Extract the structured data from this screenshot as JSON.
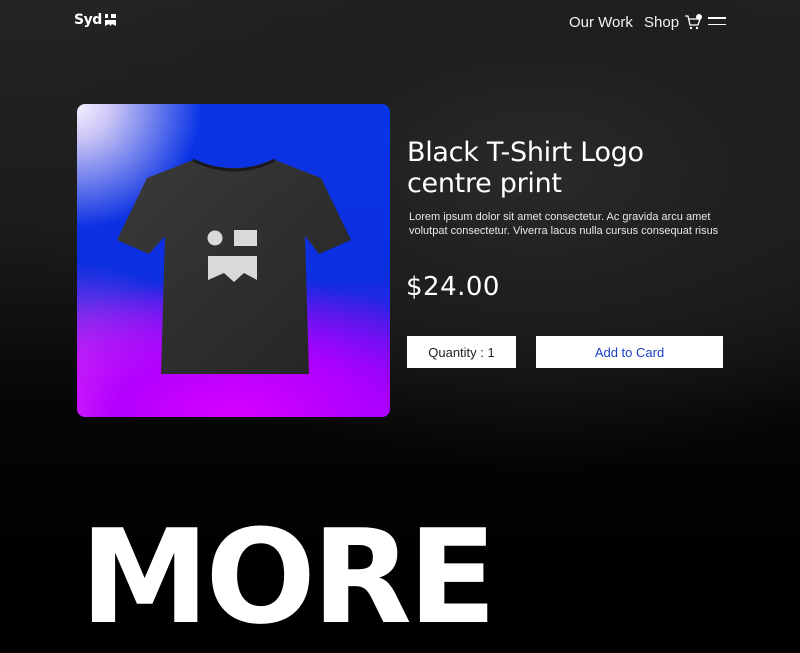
{
  "brand": {
    "name": "Syd"
  },
  "nav": {
    "links": [
      "Our Work",
      "Shop"
    ],
    "icons": [
      "cart-icon",
      "menu-icon"
    ]
  },
  "product": {
    "title_line1": "Black T-Shirt Logo",
    "title_line2": "centre print",
    "description_line1": "Lorem ipsum dolor sit amet consectetur. Ac gravida arcu amet",
    "description_line2": "volutpat consectetur. Viverra lacus nulla cursus consequat risus",
    "price": "$24.00",
    "quantity_label": "Quantity : 1",
    "add_button": "Add to Card"
  },
  "section": {
    "heading": "MORE"
  },
  "colors": {
    "accent_blue": "#1a3ec7",
    "card_blue": "#0c2fe0",
    "card_magenta": "#d800ff"
  }
}
